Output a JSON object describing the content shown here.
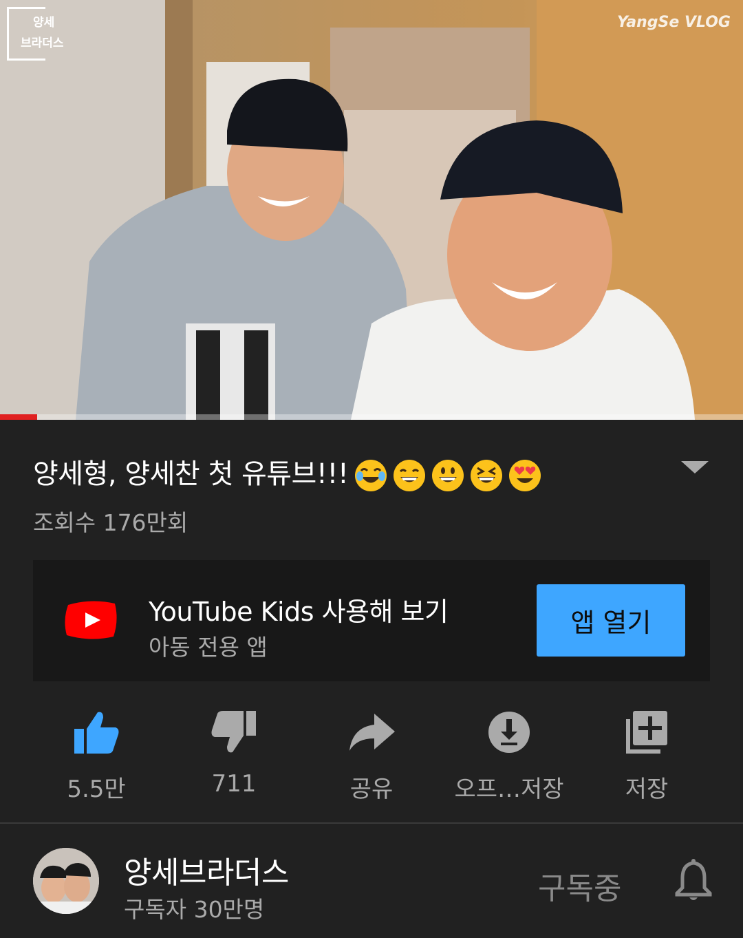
{
  "video": {
    "watermark_logo_line1": "양세",
    "watermark_logo_line2": "브라더스",
    "watermark_vlog": "YangSe VLOG",
    "progress_fraction": 0.05,
    "progress_color": "#e02020"
  },
  "title": {
    "text": "양세형, 양세찬 첫 유튜브!!!",
    "emojis": [
      "joy-emoji",
      "grin-emoji",
      "smiley-emoji",
      "laughing-emoji",
      "heart-eyes-emoji"
    ]
  },
  "views": "조회수 176만회",
  "kids_promo": {
    "title": "YouTube Kids 사용해 보기",
    "subtitle": "아동 전용 앱",
    "button": "앱 열기",
    "button_color": "#3ea6ff"
  },
  "actions": [
    {
      "icon": "thumbs-up-icon",
      "label": "5.5만",
      "active_color": "#3ea6ff"
    },
    {
      "icon": "thumbs-down-icon",
      "label": "711"
    },
    {
      "icon": "share-icon",
      "label": "공유"
    },
    {
      "icon": "download-icon",
      "label": "오프…저장"
    },
    {
      "icon": "add-to-playlist-icon",
      "label": "저장"
    }
  ],
  "channel": {
    "name": "양세브라더스",
    "subscribers": "구독자 30만명",
    "subscribe_state": "구독중"
  }
}
